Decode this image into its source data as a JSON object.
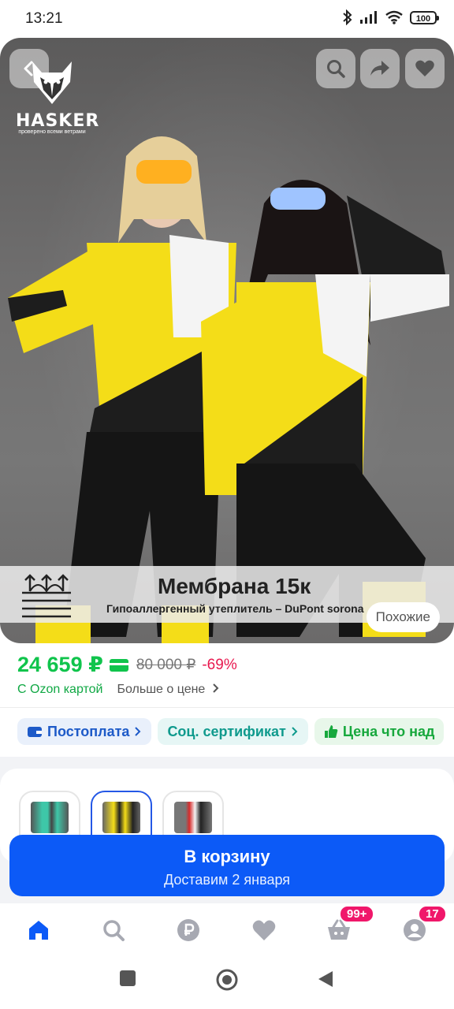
{
  "status_bar": {
    "time": "13:21",
    "battery": "100"
  },
  "hero": {
    "brand_name": "HASKER",
    "brand_tagline": "проверено всеми ветрами",
    "banner_title": "Мембрана 15к",
    "banner_subtitle": "Гипоаллергенный утеплитель – DuPont sorona",
    "similar_label": "Похожие",
    "icons": [
      "back-icon",
      "search-icon",
      "share-icon",
      "heart-icon"
    ]
  },
  "price": {
    "current": "24 659 ₽",
    "old": "80 000 ₽",
    "discount": "-69%",
    "ozon_card": "С Ozon картой",
    "more_price": "Больше о цене"
  },
  "chips": [
    {
      "label": "Постоплата",
      "icon": "wallet-icon"
    },
    {
      "label": "Соц. сертификат",
      "icon": "chevron-right-icon"
    },
    {
      "label": "Цена что над",
      "icon": "thumbs-up-icon"
    }
  ],
  "variants": [
    {
      "name": "mint-variant",
      "color": "#3ec7a8"
    },
    {
      "name": "yellow-variant",
      "color": "#f4dd18"
    },
    {
      "name": "red-variant",
      "color": "#d62b2b"
    }
  ],
  "cart": {
    "title": "В корзину",
    "subtitle": "Доставим 2 января"
  },
  "nav": {
    "cart_badge": "99+",
    "profile_badge": "17"
  },
  "colors": {
    "accent": "#0c5af7",
    "price_green": "#10c44c",
    "discount_pink": "#e8194f",
    "badge_pink": "#f0176a"
  }
}
